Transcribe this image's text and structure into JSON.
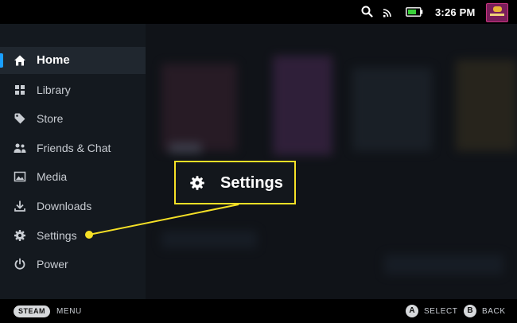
{
  "status_bar": {
    "time": "3:26 PM",
    "icons": [
      "search-icon",
      "cast-icon",
      "battery-icon"
    ],
    "battery_color": "#3ad13a"
  },
  "sidebar": {
    "accent_color": "#1a9fff",
    "items": [
      {
        "label": "Home",
        "icon": "home-icon",
        "active": true
      },
      {
        "label": "Library",
        "icon": "grid-icon",
        "active": false
      },
      {
        "label": "Store",
        "icon": "tag-icon",
        "active": false
      },
      {
        "label": "Friends & Chat",
        "icon": "friends-icon",
        "active": false
      },
      {
        "label": "Media",
        "icon": "image-icon",
        "active": false
      },
      {
        "label": "Downloads",
        "icon": "download-icon",
        "active": false
      },
      {
        "label": "Settings",
        "icon": "gear-icon",
        "active": false
      },
      {
        "label": "Power",
        "icon": "power-icon",
        "active": false
      }
    ]
  },
  "callout": {
    "label": "Settings",
    "icon": "gear-icon",
    "highlight_color": "#f5e026"
  },
  "footer": {
    "steam_label": "STEAM",
    "menu_label": "MENU",
    "a_button": "A",
    "select_label": "SELECT",
    "b_button": "B",
    "back_label": "BACK"
  }
}
